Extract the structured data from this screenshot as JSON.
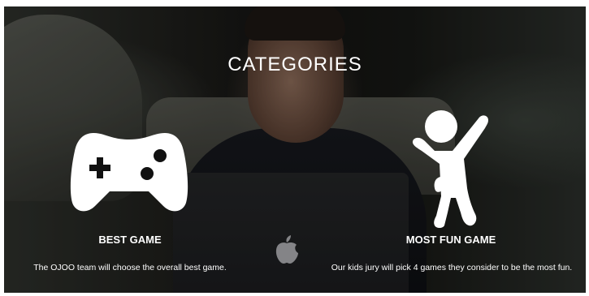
{
  "section_title": "CATEGORIES",
  "categories": [
    {
      "icon": "gamepad-icon",
      "title": "BEST GAME",
      "description": "The OJOO team will choose the overall best game."
    },
    {
      "icon": "jumping-kid-icon",
      "title": "MOST FUN GAME",
      "description": "Our kids jury will pick 4 games they consider to be the most fun."
    }
  ]
}
